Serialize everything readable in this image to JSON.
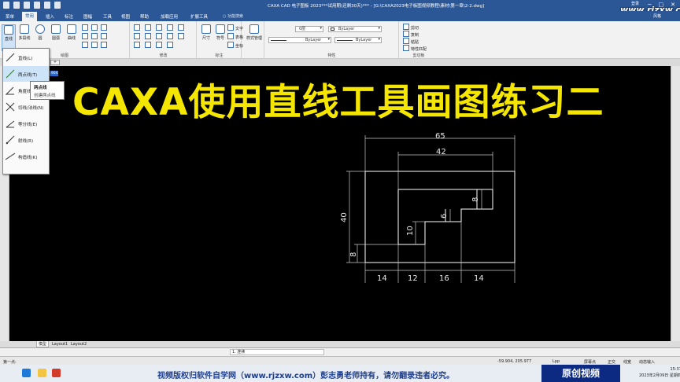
{
  "window": {
    "title": "CAXA CAD 电子图板 2023***试用期(还剩30天)*** - [G:\\CAXA2023电子板图视频教程\\素材\\第一章\\2-2.dwg]",
    "login": "登录",
    "controls": [
      "─",
      "□",
      "✕"
    ]
  },
  "site_logo": "www.rjzxw.com",
  "menu_tabs": [
    {
      "label": "菜单",
      "active": false
    },
    {
      "label": "常用",
      "active": true
    },
    {
      "label": "插入",
      "active": false
    },
    {
      "label": "标注",
      "active": false
    },
    {
      "label": "图幅",
      "active": false
    },
    {
      "label": "工具",
      "active": false
    },
    {
      "label": "视图",
      "active": false
    },
    {
      "label": "帮助",
      "active": false
    },
    {
      "label": "加载应用",
      "active": false
    },
    {
      "label": "扩展工具",
      "active": false
    }
  ],
  "search_placeholder": "功能搜索",
  "style_selector": "风格",
  "ribbon": {
    "draw_group": {
      "label": "绘图",
      "buttons": [
        "直线",
        "多段线",
        "圆",
        "圆弧",
        "曲线"
      ]
    },
    "modify_group": {
      "label": "修改"
    },
    "annotate_group": {
      "label": "标注",
      "buttons": [
        "尺寸",
        "符号"
      ],
      "small": [
        "文字",
        "表格",
        "坐标"
      ]
    },
    "style_group": {
      "label": "样式管理"
    },
    "property_group": {
      "label": "特性",
      "layer": "0层",
      "color": "ByLayer",
      "linetype": "ByLayer",
      "lineweight": "ByLayer"
    },
    "clipboard_group": {
      "label": "剪切板",
      "items": [
        "剪切",
        "复制",
        "粘贴",
        "特性匹配"
      ]
    }
  },
  "dropdown": {
    "items": [
      {
        "label": "直线(L)",
        "icon": "line-icon"
      },
      {
        "label": "两点线(T)",
        "icon": "two-point-line-icon",
        "highlight": true
      },
      {
        "label": "角度线(A)",
        "icon": "angle-line-icon"
      },
      {
        "label": "切线/法线(N)",
        "icon": "tangent-line-icon"
      },
      {
        "label": "等分线(E)",
        "icon": "bisect-line-icon"
      },
      {
        "label": "射线(R)",
        "icon": "ray-icon"
      },
      {
        "label": "构造线(K)",
        "icon": "construction-line-icon"
      }
    ],
    "tooltip_title": "两点线",
    "tooltip_desc": "创建两点线"
  },
  "file_tab": "+",
  "cursor_hint": "3.904",
  "overlay_title": "CAXA使用直线工具画图练习二",
  "drawing": {
    "dimensions": {
      "top_outer": "65",
      "top_inner": "42",
      "left_height": "40",
      "left_small": "8",
      "inner_10": "10",
      "inner_6": "6",
      "inner_8": "8",
      "bottom": [
        "14",
        "12",
        "16",
        "14"
      ]
    },
    "colors": {
      "geometry": "#ffffff",
      "dimension": "#c8c8c8"
    }
  },
  "layout_tabs": [
    {
      "label": "模型",
      "active": true
    },
    {
      "label": "Layout1",
      "active": false
    },
    {
      "label": "Layout2",
      "active": false
    }
  ],
  "command": {
    "prompt": "第一点:",
    "mode": "1. 连续"
  },
  "status": {
    "coords": "-59.904, 205.977",
    "lpp": "Lpp",
    "snap": "屏幕点",
    "toggles": [
      "正交",
      "线宽",
      "动态输入"
    ]
  },
  "watermark_banner": "视频版权归软件自学网（www.rjzxw.com）彭志勇老师持有，请勿翻录违者必究。",
  "original_badge": "原创视频",
  "clock": {
    "time": "15:37",
    "date": "2023年2月09日 星期四"
  }
}
